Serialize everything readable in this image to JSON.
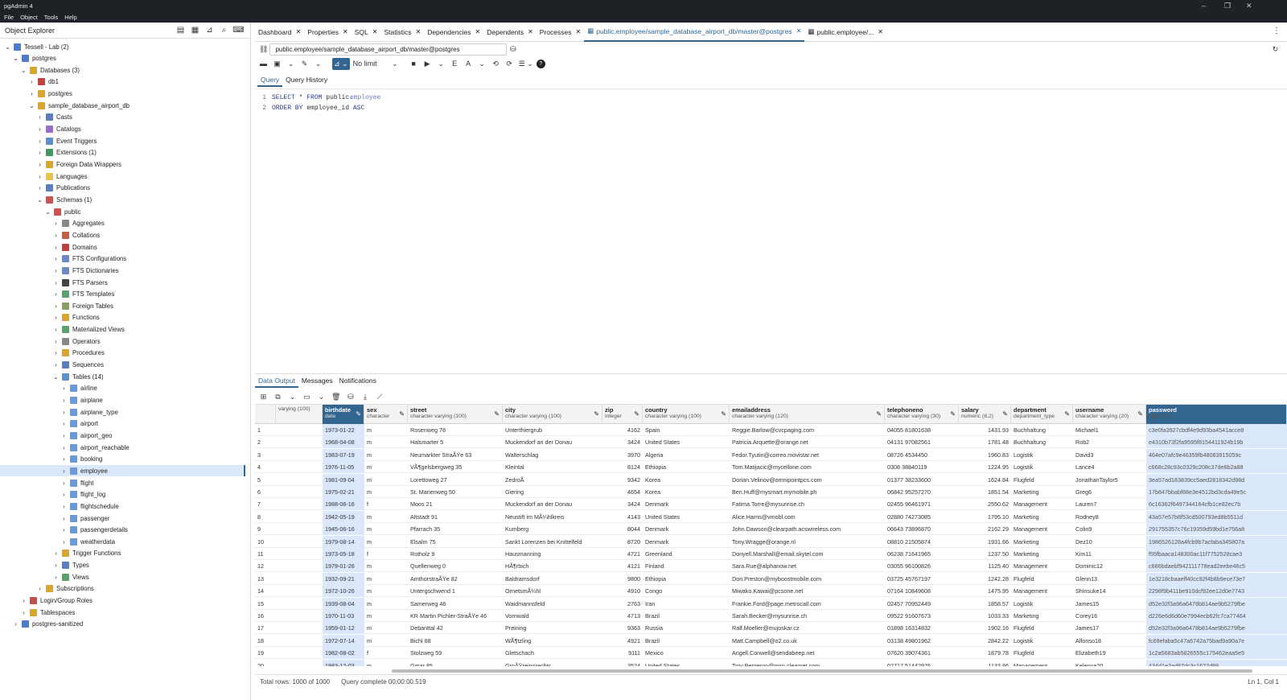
{
  "window": {
    "title": "pgAdmin 4"
  },
  "menu": [
    "File",
    "Object",
    "Tools",
    "Help"
  ],
  "sidebar": {
    "title": "Object Explorer",
    "tree": [
      {
        "label": "Tessell - Lab (2)",
        "level": 0,
        "caret": "⌄",
        "color": "#4a7bd0",
        "icon": "server-group-icon"
      },
      {
        "label": "postgres",
        "level": 1,
        "caret": "⌄",
        "color": "#4a7bd0",
        "icon": "server-icon"
      },
      {
        "label": "Databases (3)",
        "level": 2,
        "caret": "⌄",
        "color": "#d9a52a",
        "icon": "databases-icon"
      },
      {
        "label": "db1",
        "level": 3,
        "caret": "›",
        "color": "#c84040",
        "icon": "database-icon"
      },
      {
        "label": "postgres",
        "level": 3,
        "caret": "›",
        "color": "#d9a52a",
        "icon": "database-icon"
      },
      {
        "label": "sample_database_airport_db",
        "level": 3,
        "caret": "⌄",
        "color": "#d9a52a",
        "icon": "database-icon"
      },
      {
        "label": "Casts",
        "level": 4,
        "caret": "›",
        "color": "#5a7fc0",
        "icon": "casts-icon"
      },
      {
        "label": "Catalogs",
        "level": 4,
        "caret": "›",
        "color": "#9a6acd",
        "icon": "catalogs-icon"
      },
      {
        "label": "Event Triggers",
        "level": 4,
        "caret": "›",
        "color": "#5a8fd0",
        "icon": "event-trigger-icon"
      },
      {
        "label": "Extensions (1)",
        "level": 4,
        "caret": "›",
        "color": "#3f9a5b",
        "icon": "extensions-icon"
      },
      {
        "label": "Foreign Data Wrappers",
        "level": 4,
        "caret": "›",
        "color": "#d9a52a",
        "icon": "fdw-icon"
      },
      {
        "label": "Languages",
        "level": 4,
        "caret": "›",
        "color": "#e6c24b",
        "icon": "languages-icon"
      },
      {
        "label": "Publications",
        "level": 4,
        "caret": "›",
        "color": "#5a7fc0",
        "icon": "publications-icon"
      },
      {
        "label": "Schemas (1)",
        "level": 4,
        "caret": "⌄",
        "color": "#d05050",
        "icon": "schemas-icon"
      },
      {
        "label": "public",
        "level": 5,
        "caret": "⌄",
        "color": "#d05050",
        "icon": "schema-icon"
      },
      {
        "label": "Aggregates",
        "level": 6,
        "caret": "›",
        "color": "#888",
        "icon": "aggregates-icon"
      },
      {
        "label": "Collations",
        "level": 6,
        "caret": "›",
        "color": "#c06040",
        "icon": "collations-icon"
      },
      {
        "label": "Domains",
        "level": 6,
        "caret": "›",
        "color": "#c04040",
        "icon": "domains-icon"
      },
      {
        "label": "FTS Configurations",
        "level": 6,
        "caret": "›",
        "color": "#6a8ac8",
        "icon": "fts-config-icon"
      },
      {
        "label": "FTS Dictionaries",
        "level": 6,
        "caret": "›",
        "color": "#6a8ac8",
        "icon": "fts-dict-icon"
      },
      {
        "label": "FTS Parsers",
        "level": 6,
        "caret": "›",
        "color": "#444",
        "icon": "fts-parser-icon"
      },
      {
        "label": "FTS Templates",
        "level": 6,
        "caret": "›",
        "color": "#5aa070",
        "icon": "fts-template-icon"
      },
      {
        "label": "Foreign Tables",
        "level": 6,
        "caret": "›",
        "color": "#8aa060",
        "icon": "foreign-tables-icon"
      },
      {
        "label": "Functions",
        "level": 6,
        "caret": "›",
        "color": "#d9a52a",
        "icon": "functions-icon"
      },
      {
        "label": "Materialized Views",
        "level": 6,
        "caret": "›",
        "color": "#5aa070",
        "icon": "mat-views-icon"
      },
      {
        "label": "Operators",
        "level": 6,
        "caret": "›",
        "color": "#888",
        "icon": "operators-icon"
      },
      {
        "label": "Procedures",
        "level": 6,
        "caret": "›",
        "color": "#d9a52a",
        "icon": "procedures-icon"
      },
      {
        "label": "Sequences",
        "level": 6,
        "caret": "›",
        "color": "#5a7fc0",
        "icon": "sequences-icon"
      },
      {
        "label": "Tables (14)",
        "level": 6,
        "caret": "⌄",
        "color": "#5a8fd0",
        "icon": "tables-icon"
      },
      {
        "label": "airline",
        "level": 7,
        "caret": "›",
        "color": "#6a9ad8",
        "icon": "table-icon"
      },
      {
        "label": "airplane",
        "level": 7,
        "caret": "›",
        "color": "#6a9ad8",
        "icon": "table-icon"
      },
      {
        "label": "airplane_type",
        "level": 7,
        "caret": "›",
        "color": "#6a9ad8",
        "icon": "table-icon"
      },
      {
        "label": "airport",
        "level": 7,
        "caret": "›",
        "color": "#6a9ad8",
        "icon": "table-icon"
      },
      {
        "label": "airport_geo",
        "level": 7,
        "caret": "›",
        "color": "#6a9ad8",
        "icon": "table-icon"
      },
      {
        "label": "airport_reachable",
        "level": 7,
        "caret": "›",
        "color": "#6a9ad8",
        "icon": "table-icon"
      },
      {
        "label": "booking",
        "level": 7,
        "caret": "›",
        "color": "#6a9ad8",
        "icon": "table-icon"
      },
      {
        "label": "employee",
        "level": 7,
        "caret": "›",
        "color": "#6a9ad8",
        "icon": "table-icon",
        "selected": true
      },
      {
        "label": "flight",
        "level": 7,
        "caret": "›",
        "color": "#6a9ad8",
        "icon": "table-icon"
      },
      {
        "label": "flight_log",
        "level": 7,
        "caret": "›",
        "color": "#6a9ad8",
        "icon": "table-icon"
      },
      {
        "label": "flightschedule",
        "level": 7,
        "caret": "›",
        "color": "#6a9ad8",
        "icon": "table-icon"
      },
      {
        "label": "passenger",
        "level": 7,
        "caret": "›",
        "color": "#6a9ad8",
        "icon": "table-icon"
      },
      {
        "label": "passengerdetails",
        "level": 7,
        "caret": "›",
        "color": "#6a9ad8",
        "icon": "table-icon"
      },
      {
        "label": "weatherdata",
        "level": 7,
        "caret": "›",
        "color": "#6a9ad8",
        "icon": "table-icon"
      },
      {
        "label": "Trigger Functions",
        "level": 6,
        "caret": "›",
        "color": "#d9a52a",
        "icon": "trigger-functions-icon"
      },
      {
        "label": "Types",
        "level": 6,
        "caret": "›",
        "color": "#5a7fc0",
        "icon": "types-icon"
      },
      {
        "label": "Views",
        "level": 6,
        "caret": "›",
        "color": "#5aa070",
        "icon": "views-icon"
      },
      {
        "label": "Subscriptions",
        "level": 4,
        "caret": "›",
        "color": "#d9a52a",
        "icon": "subscriptions-icon"
      },
      {
        "label": "Login/Group Roles",
        "level": 2,
        "caret": "›",
        "color": "#c05050",
        "icon": "roles-icon"
      },
      {
        "label": "Tablespaces",
        "level": 2,
        "caret": "›",
        "color": "#d9a52a",
        "icon": "tablespaces-icon"
      },
      {
        "label": "postgres-sanitized",
        "level": 1,
        "caret": "›",
        "color": "#4a7bd0",
        "icon": "server-icon"
      }
    ]
  },
  "tabs": [
    {
      "label": "Dashboard"
    },
    {
      "label": "Properties"
    },
    {
      "label": "SQL"
    },
    {
      "label": "Statistics"
    },
    {
      "label": "Dependencies"
    },
    {
      "label": "Dependents"
    },
    {
      "label": "Processes"
    },
    {
      "label": "public.employee/sample_database_airport_db/master@postgres",
      "active": true
    },
    {
      "label": "public.employee/..."
    }
  ],
  "query_tool": {
    "connection": "public.employee/sample_database_airport_db/master@postgres",
    "limit": "No limit",
    "tabs": [
      "Query",
      "Query History"
    ],
    "lines": [
      "1",
      "2"
    ],
    "sql": [
      [
        "SELECT",
        "*",
        "FROM",
        "public.",
        "employee"
      ],
      [
        "ORDER BY",
        "employee_id",
        "ASC"
      ]
    ]
  },
  "output": {
    "tabs": [
      "Data Output",
      "Messages",
      "Notifications"
    ],
    "columns": [
      {
        "name": "",
        "type": "varying (100)"
      },
      {
        "name": "birthdate",
        "type": "date"
      },
      {
        "name": "sex",
        "type": "character"
      },
      {
        "name": "street",
        "type": "character varying (100)"
      },
      {
        "name": "city",
        "type": "character varying (100)"
      },
      {
        "name": "zip",
        "type": "integer"
      },
      {
        "name": "country",
        "type": "character varying (100)"
      },
      {
        "name": "emailaddress",
        "type": "character varying (120)"
      },
      {
        "name": "telephoneno",
        "type": "character varying (30)"
      },
      {
        "name": "salary",
        "type": "numeric (8,2)"
      },
      {
        "name": "department",
        "type": "department_type"
      },
      {
        "name": "username",
        "type": "character varying (20)"
      },
      {
        "name": "password",
        "type": "character"
      }
    ],
    "rows": [
      [
        "1",
        "",
        "1973-01-22",
        "m",
        "Rosenweg 78",
        "Unterthiergrub",
        "4162",
        "Spain",
        "Reggie.Barlow@cvcpaging.com",
        "04055 81801638",
        "1431.93",
        "Buchhaltung",
        "Michael1",
        "c3e0fa3927cbdf4e9d93ba4541acce8"
      ],
      [
        "2",
        "",
        "1968-04-08",
        "m",
        "Halsmarter 5",
        "Muckendorf an der Donau",
        "3424",
        "United States",
        "Patricia.Arquette@orange.net",
        "04131 97082561",
        "1781.48",
        "Buchhaltung",
        "Rob2",
        "e4310b73f2fa9595f8154411924b19b"
      ],
      [
        "3",
        "",
        "1983-07-19",
        "m",
        "Neumarkter StraÃŸe 63",
        "Walterschlag",
        "3970",
        "Algeria",
        "Fedor.Tyutin@correo.movistar.net",
        "08726 4534450",
        "1960.83",
        "Logistik",
        "David3",
        "464e07afc9e46359fb48083915059c"
      ],
      [
        "4",
        "",
        "1976-11-05",
        "m",
        "VÃ¶gelsbergweg 35",
        "Kleintal",
        "8124",
        "Ethiopia",
        "Tom.Matijacic@mycellone.com",
        "0308 38840119",
        "1224.95",
        "Logistik",
        "Lance4",
        "c668c28c93c0329c208c37de8b2a88"
      ],
      [
        "5",
        "",
        "1981-09-04",
        "m",
        "Lorettoweg 27",
        "ZedroÃ",
        "9342",
        "Korea",
        "Dorian.Velinov@omnipointpcs.com",
        "01377 38233600",
        "1624.84",
        "Flugfeld",
        "JonathanTaylor5",
        "3ea57ad183839cc5aed2818342d98d"
      ],
      [
        "6",
        "",
        "1975-02-21",
        "m",
        "St. Marienweg 50",
        "Giering",
        "4654",
        "Korea",
        "Ben.Huff@mysmart.mymobile.ph",
        "06842 95257270",
        "1851.54",
        "Marketing",
        "Greg6",
        "17b847bbabf88e3e4512bd3cda49e5c"
      ],
      [
        "7",
        "",
        "1988-06-16",
        "f",
        "Moos 21",
        "Muckendorf an der Donau",
        "3424",
        "Denmark",
        "Fatima.Torre@mysunrise.ch",
        "02455 96461971",
        "2550.62",
        "Management",
        "Lauren7",
        "6c16362f6497344164cfb1ce82ec7b"
      ],
      [
        "8",
        "",
        "1942-05-19",
        "m",
        "Altstadt 91",
        "Neustift im MÃ¼hlkreis",
        "4143",
        "United States",
        "Alice.Harris@vmobl.com",
        "02880 74273085",
        "1795.10",
        "Marketing",
        "Rodney8",
        "43a57e57b8f53cd500793ed8b5511d"
      ],
      [
        "9",
        "",
        "1945-06-16",
        "m",
        "Pfarrach 35",
        "Kumberg",
        "8044",
        "Denmark",
        "John.Dawson@clearpath.acswireless.com",
        "06643 73896870",
        "2162.29",
        "Management",
        "Colin9",
        "291755357c76c19359d59bd1e756a8"
      ],
      [
        "10",
        "",
        "1979-08-14",
        "m",
        "Elsalm 75",
        "Sankt Lorenzen bei Knittelfeld",
        "8720",
        "Denmark",
        "Tony.Wragge@orange.nl",
        "08810 21505874",
        "1931.66",
        "Marketing",
        "Dez10",
        "1986526128a4fcb9b7acfaba345807a"
      ],
      [
        "11",
        "",
        "1973-05-18",
        "f",
        "Rotholz 9",
        "Hausmanning",
        "4721",
        "Greenland",
        "Donyell.Marshall@email.skytel.com",
        "06238 71641965",
        "1237.50",
        "Marketing",
        "Kim11",
        "f55fbaaca148300ac11f7752528cae3"
      ],
      [
        "12",
        "",
        "1979-01-26",
        "m",
        "Quellenweg 0",
        "HÃ¶rbich",
        "4121",
        "Finland",
        "Sara.Rue@alphanow.net",
        "03055 96100826",
        "1125.40",
        "Management",
        "Dominic12",
        "c686bdaebf942111778ead2eebe46c5"
      ],
      [
        "13",
        "",
        "1932-09-21",
        "m",
        "AmthorstraÃŸe 82",
        "Baldramsdorf",
        "9800",
        "Ethiopia",
        "Don.Preston@myboostmobile.com",
        "03725 45767197",
        "1242.28",
        "Flugfeld",
        "Glenn13",
        "1e3218cbaaeff40cc92f4b8b9ece73e7"
      ],
      [
        "14",
        "",
        "1972-10-26",
        "m",
        "Untergschwend 1",
        "OrnetsmÃ¼hl",
        "4910",
        "Congo",
        "Miwako.Kawai@pcsone.net",
        "07164 10849608",
        "1475.95",
        "Management",
        "Shinsuke14",
        "2298f9b411be910dcf92ee12d0e7743"
      ],
      [
        "15",
        "",
        "1939-08-04",
        "m",
        "Samerweg 46",
        "Waidmannsfeld",
        "2763",
        "Iran",
        "Frankie.Ford@page.metrocall.com",
        "02457 70952449",
        "1858.57",
        "Logistik",
        "James15",
        "d52e32f3a96a6478b814ae9b5279fbe"
      ],
      [
        "16",
        "",
        "1970-11-03",
        "m",
        "KR Martin Pichler-StraÃŸe 46",
        "Vornwald",
        "4713",
        "Brazil",
        "Sarah.Becker@mysunrise.ch",
        "09522 91607673",
        "1033.33",
        "Marketing",
        "Corey16",
        "d226e6d6d60e7994ecb62fc7ca77464"
      ],
      [
        "17",
        "",
        "1959-01-12",
        "m",
        "Debanttal 42",
        "Preining",
        "9363",
        "Russia",
        "Ralf.Moeller@mujoskar.cz",
        "01898 16314832",
        "1902.16",
        "Flugfeld",
        "James17",
        "d52e32f3a96a6478b814ae9b5279fbe"
      ],
      [
        "18",
        "",
        "1972-07-14",
        "m",
        "Bichl 88",
        "WÃ¶tzling",
        "4921",
        "Brazil",
        "Matt.Campbell@o2.co.uk",
        "03138 49801962",
        "2842.22",
        "Logistik",
        "Alfonso18",
        "fc69efaba5c47a6742a75bad9a90a7e"
      ],
      [
        "19",
        "",
        "1982-08-02",
        "f",
        "Stolzweg 59",
        "Gletschach",
        "9111",
        "Mexico",
        "Angell.Conwell@sendabeep.net",
        "07620 39074361",
        "1879.78",
        "Flugfeld",
        "Elizabeth19",
        "1c2a5683ab5826555c175462eaa5e5"
      ],
      [
        "20",
        "",
        "1983-12-03",
        "m",
        "Gmar 85",
        "GroÃŸreinprechts",
        "3524",
        "United States",
        "Troy.Bergeron@msn.clearnet.com",
        "02717 51442976",
        "1133.86",
        "Management",
        "Kelenna20",
        "434d1e3ad87dc3c1627d99"
      ]
    ]
  },
  "status": {
    "rows": "Total rows: 1000 of 1000",
    "query": "Query complete 00:00:00.519",
    "cursor": "Ln 1, Col 1"
  }
}
